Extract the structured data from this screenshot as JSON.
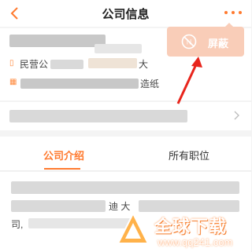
{
  "header": {
    "title": "公司信息",
    "back_icon": "chevron-left-icon",
    "more_icon": "more-dots-icon"
  },
  "company": {
    "type_partial": "民营公",
    "desc_partial": "造纸",
    "trailing_partial": "大"
  },
  "tabs": [
    {
      "label": "公司介绍",
      "active": true
    },
    {
      "label": "所有职位",
      "active": false
    }
  ],
  "popup": {
    "block_label": "屏蔽",
    "icon": "block-icon"
  },
  "intro": {
    "partial_1": "迪 大",
    "partial_2": "司,"
  },
  "watermark": {
    "title": "全球下载",
    "url": "www.qq241.com"
  },
  "colors": {
    "accent": "#ff7a2f",
    "popup_bg": "#f9cdb8",
    "annotation_arrow": "#e8251c"
  }
}
